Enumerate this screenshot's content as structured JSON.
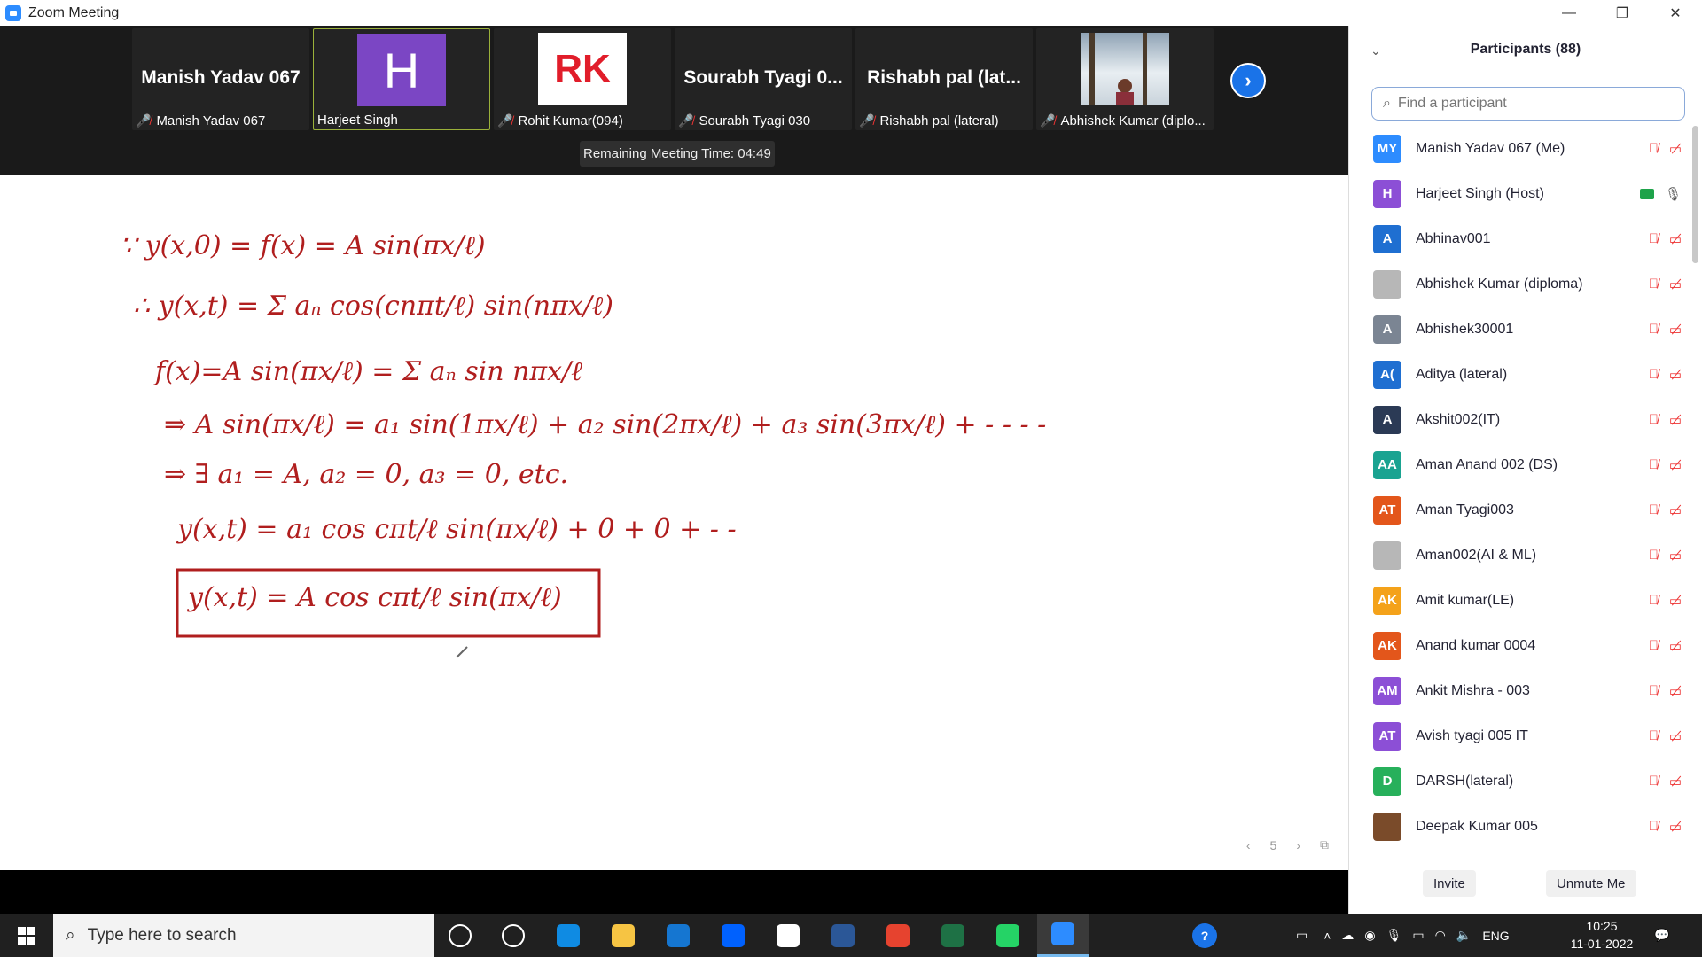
{
  "window": {
    "title": "Zoom Meeting",
    "controls": {
      "minimize": "—",
      "restore": "❐",
      "close": "✕"
    }
  },
  "video_tiles": [
    {
      "big_name": "Manish Yadav 067",
      "label": "Manish Yadav 067",
      "muted": true,
      "avatar": ""
    },
    {
      "big_name": "",
      "label": "Harjeet Singh",
      "muted": false,
      "avatar": "H"
    },
    {
      "big_name": "",
      "label": "Rohit Kumar(094)",
      "muted": true,
      "avatar": "RK"
    },
    {
      "big_name": "Sourabh Tyagi 0...",
      "label": "Sourabh Tyagi 030",
      "muted": true,
      "avatar": ""
    },
    {
      "big_name": "Rishabh pal (lat...",
      "label": "Rishabh pal (lateral)",
      "muted": true,
      "avatar": ""
    },
    {
      "big_name": "",
      "label": "Abhishek Kumar (diplo...",
      "muted": true,
      "avatar": "photo"
    }
  ],
  "meeting": {
    "remaining_time": "Remaining Meeting Time: 04:49"
  },
  "whiteboard": {
    "page_number": "5",
    "lines": [
      "∵ y(x,0) = f(x) = A sin(πx/ℓ)",
      "∴ y(x,t) = Σ aₙ cos(cnπt/ℓ) sin(nπx/ℓ)",
      "f(x)=A sin(πx/ℓ) = Σ aₙ sin nπx/ℓ",
      "⇒ A sin(πx/ℓ) = a₁ sin(1πx/ℓ) + a₂ sin(2πx/ℓ) + a₃ sin(3πx/ℓ) + - - -   -",
      "⇒ ∃ a₁ = A, a₂ = 0, a₃ = 0, etc.",
      "y(x,t) = a₁ cos cπt/ℓ sin(πx/ℓ) + 0 + 0 + -   -",
      "y(x,t) = A cos cπt/ℓ sin(πx/ℓ)"
    ],
    "ink_color": "#b01e1e"
  },
  "participants": {
    "title": "Participants (88)",
    "search_placeholder": "Find a participant",
    "list": [
      {
        "initials": "MY",
        "name": "Manish Yadav 067 (Me)",
        "color": "#2D8CFF",
        "host": false
      },
      {
        "initials": "H",
        "name": "Harjeet Singh (Host)",
        "color": "#8c4fd6",
        "host": true
      },
      {
        "initials": "A",
        "name": "Abhinav001",
        "color": "#1f6fd1",
        "host": false
      },
      {
        "initials": "",
        "name": "Abhishek Kumar (diploma)",
        "color": "#b7b7b7",
        "host": false
      },
      {
        "initials": "A",
        "name": "Abhishek30001",
        "color": "#7b8593",
        "host": false
      },
      {
        "initials": "A(",
        "name": "Aditya (lateral)",
        "color": "#1f6fd1",
        "host": false
      },
      {
        "initials": "A",
        "name": "Akshit002(IT)",
        "color": "#2b3a55",
        "host": false
      },
      {
        "initials": "AA",
        "name": "Aman Anand 002 (DS)",
        "color": "#1aa391",
        "host": false
      },
      {
        "initials": "AT",
        "name": "Aman Tyagi003",
        "color": "#e3561b",
        "host": false
      },
      {
        "initials": "",
        "name": "Aman002(AI & ML)",
        "color": "#b7b7b7",
        "host": false
      },
      {
        "initials": "AK",
        "name": "Amit kumar(LE)",
        "color": "#f4a21a",
        "host": false
      },
      {
        "initials": "AK",
        "name": "Anand kumar 0004",
        "color": "#e3561b",
        "host": false
      },
      {
        "initials": "AM",
        "name": "Ankit Mishra - 003",
        "color": "#8c4fd6",
        "host": false
      },
      {
        "initials": "AT",
        "name": "Avish tyagi 005 IT",
        "color": "#8c4fd6",
        "host": false
      },
      {
        "initials": "D",
        "name": "DARSH(lateral)",
        "color": "#27b05b",
        "host": false
      },
      {
        "initials": "",
        "name": "Deepak Kumar 005",
        "color": "#7a4b2a",
        "host": false
      }
    ],
    "invite_label": "Invite",
    "unmute_label": "Unmute Me"
  },
  "taskbar": {
    "search_text": "Type here to search",
    "icons": [
      "cortana-icon",
      "task-view-icon",
      "edge-icon",
      "file-explorer-icon",
      "mail-icon",
      "dropbox-icon",
      "app-icon",
      "word-icon",
      "chrome-icon",
      "excel-icon",
      "whatsapp-icon",
      "zoom-icon"
    ],
    "language": "ENG",
    "time": "10:25",
    "date": "11-01-2022"
  }
}
